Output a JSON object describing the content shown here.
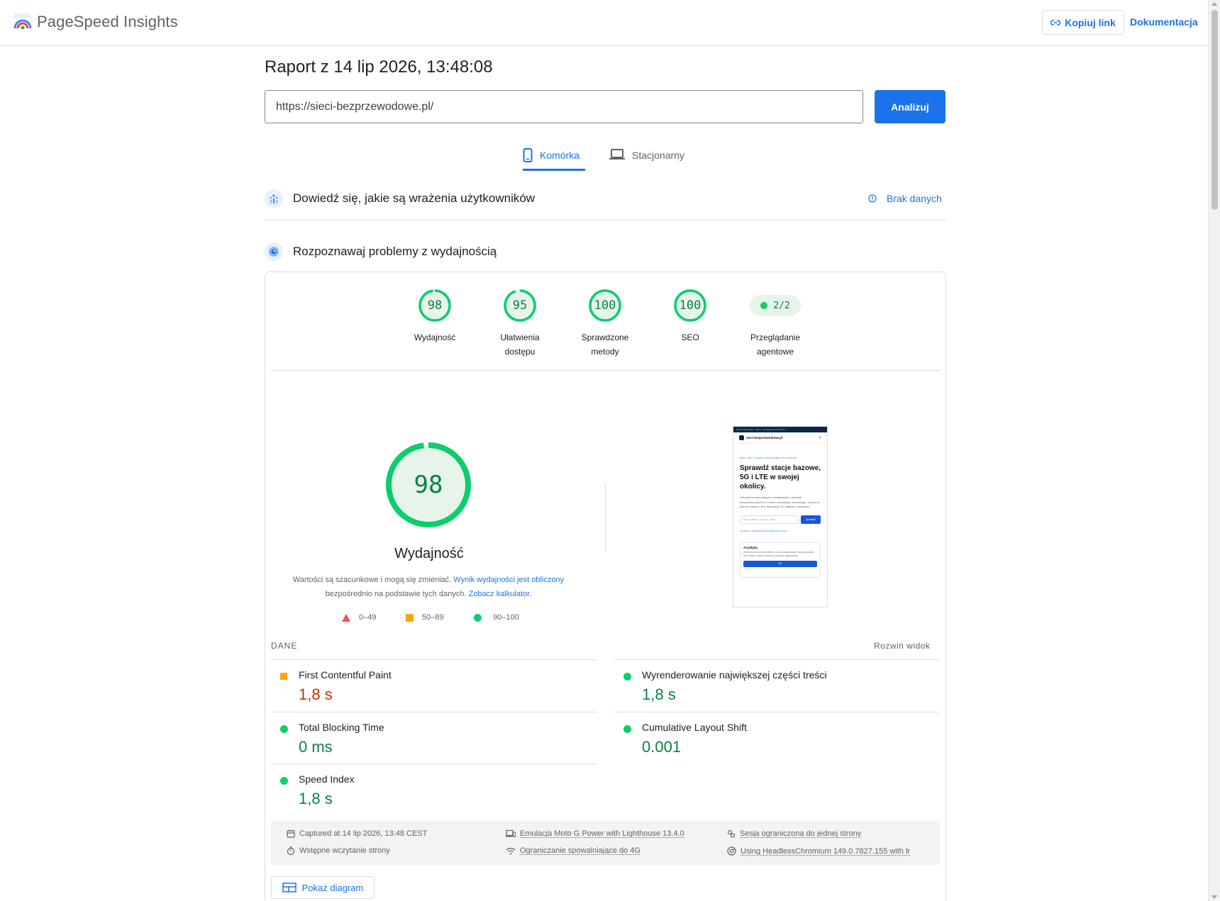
{
  "header": {
    "brand": "PageSpeed Insights",
    "copy_link": "Kopiuj link",
    "docs": "Dokumentacja"
  },
  "report": {
    "title": "Raport z 14 lip 2026, 13:48:08",
    "url": "https://sieci-bezprzewodowe.pl/",
    "analyze": "Analizuj"
  },
  "tabs": [
    {
      "label": "Komórka",
      "active": true
    },
    {
      "label": "Stacjonarny",
      "active": false
    }
  ],
  "crux": {
    "title": "Dowiedź się, jakie są wrażenia użytkowników",
    "status": "Brak danych"
  },
  "lab": {
    "title": "Rozpoznawaj problemy z wydajnością"
  },
  "scores": [
    {
      "value": "98",
      "score": 98,
      "label_1": "Wydajność",
      "label_2": ""
    },
    {
      "value": "95",
      "score": 95,
      "label_1": "Ułatwienia",
      "label_2": "dostępu"
    },
    {
      "value": "100",
      "score": 100,
      "label_1": "Sprawdzone",
      "label_2": "metody"
    },
    {
      "value": "100",
      "score": 100,
      "label_1": "SEO",
      "label_2": ""
    }
  ],
  "agentic": {
    "value": "2/2",
    "label_1": "Przeglądanie",
    "label_2": "agentowe"
  },
  "performance": {
    "score": "98",
    "score_value": 98,
    "label": "Wydajność",
    "estimate_text_1": "Wartości są szacunkowe i mogą się zmieniać.",
    "estimate_link_1": "Wynik wydajności jest obliczony",
    "estimate_text_2": "bezpośrednio na podstawie tych danych.",
    "estimate_link_2": "Zobacz kalkulator",
    "estimate_text_3": "."
  },
  "legend": [
    {
      "range": "0–49",
      "color": "#ff4e42"
    },
    {
      "range": "50–89",
      "color": "#ffa400"
    },
    {
      "range": "90–100",
      "color": "#0cce6b"
    }
  ],
  "thumbnail": {
    "top_bar": "Źródło: Baza UKE · Import: aktualizacja 17.06.2026",
    "site_name": "sieci-bezprzewodowe.pl",
    "breadcrumb": "BAZA · MAPY · ANALIZY USŁUG MOBILNYCH W POLSCE",
    "heading": "Sprawdź stacje bazowe, 5G i LTE w swojej okolicy.",
    "paragraph": "Niezależna baza danych o nadajnikach i sieciach bezprzewodowych w Polsce: operatorzy, technologie i pasma w jednym miejscu. Bez rejestracji, bez płatnych dodatków.",
    "search_placeholder": "Wpisz miasto, np. Łódź, Warsz",
    "search_button": "Sprawdź",
    "popular": "Popularne:  Łódź  Warszawa  5G  3500 MHz  Orange",
    "cookie_title": "Analityka",
    "cookie_text": "Zbieramy anonimowe dane o ruchu podstronach, aby sprawdzić, które treści i widoki stacji są używane najczęściej.",
    "cookie_button": "OK"
  },
  "metrics_header": {
    "label": "DANE",
    "expand": "Rozwiń widok"
  },
  "metrics": {
    "fcp": {
      "name": "First Contentful Paint",
      "value": "1,8 s",
      "rating": "average"
    },
    "lcp": {
      "name": "Wyrenderowanie największej części treści",
      "value": "1,8 s",
      "rating": "pass"
    },
    "tbt": {
      "name": "Total Blocking Time",
      "value": "0 ms",
      "rating": "pass"
    },
    "cls": {
      "name": "Cumulative Layout Shift",
      "value": "0.001",
      "rating": "pass"
    },
    "si": {
      "name": "Speed Index",
      "value": "1,8 s",
      "rating": "pass"
    }
  },
  "environment": {
    "captured": "Captured at 14 lip 2026, 13:48 CEST",
    "initial_load": "Wstępne wczytanie strony",
    "emulation": "Emulacja Moto G Power with Lighthouse 13.4.0",
    "throttling": "Ograniczanie spowalniające do 4G",
    "session": "Sesja ograniczona do jednej strony",
    "browser": "Using HeadlessChromium 149.0.7827.155 with lr"
  },
  "diagram_button": "Pokaż diagram",
  "colors": {
    "accent": "#1a73e8",
    "pass": "#0cce6b",
    "pass_text": "#0b8043",
    "average": "#ffa400",
    "fail": "#ff4e42",
    "average_text": "#c33300"
  }
}
